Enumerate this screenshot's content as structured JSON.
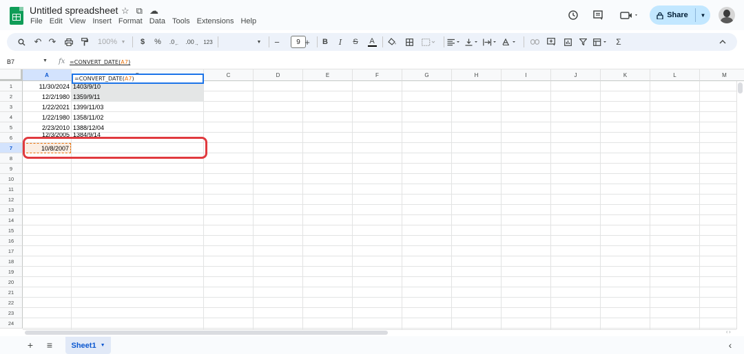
{
  "header": {
    "doc_title": "Untitled spreadsheet",
    "title_icons": [
      "star-icon",
      "move-to-folder-icon",
      "cloud-status-icon"
    ],
    "menu": [
      "File",
      "Edit",
      "View",
      "Insert",
      "Format",
      "Data",
      "Tools",
      "Extensions",
      "Help"
    ],
    "right_icons": [
      "history-icon",
      "comments-icon",
      "meet-video-icon"
    ],
    "share_label": "Share"
  },
  "toolbar": {
    "zoom": "100%",
    "currency": "$",
    "percent": "%",
    "decrease_decimal": ".0",
    "increase_decimal": ".00",
    "more_formats": "123",
    "font_size": "9",
    "minus": "−",
    "plus": "+",
    "bold": "B",
    "italic": "I",
    "strike": "S",
    "text_color": "A",
    "sum": "Σ"
  },
  "formula_bar": {
    "name_box": "B7",
    "fx": "fx",
    "formula_prefix": "=CONVERT_DATE(",
    "formula_ref": "A7",
    "formula_suffix": ")"
  },
  "grid": {
    "columns": [
      "A",
      "B",
      "C",
      "D",
      "E",
      "F",
      "G",
      "H",
      "I",
      "J",
      "K",
      "L",
      "M"
    ],
    "rows": [
      "1",
      "2",
      "3",
      "4",
      "5",
      "6",
      "7",
      "8",
      "9",
      "10",
      "11",
      "12",
      "13",
      "14",
      "15",
      "16",
      "17",
      "18",
      "19",
      "20",
      "21",
      "22",
      "23",
      "24"
    ],
    "active_cell": "B7",
    "data": [
      {
        "a": "11/30/2024",
        "b": "1403/9/10"
      },
      {
        "a": "12/2/1980",
        "b": "1359/9/11"
      },
      {
        "a": "1/22/2021",
        "b": "1399/11/03"
      },
      {
        "a": "1/22/1980",
        "b": "1358/11/02"
      },
      {
        "a": "2/23/2010",
        "b": "1388/12/04"
      },
      {
        "a": "12/3/2005",
        "b": "1384/9/14"
      },
      {
        "a": "10/8/2007",
        "b": ""
      }
    ],
    "edit": {
      "prefix": "=CONVERT_DATE(",
      "ref": "A7",
      "suffix": ")"
    }
  },
  "bottom": {
    "add": "+",
    "all_sheets": "≡",
    "sheet_tab": "Sheet1",
    "collapse": "‹"
  }
}
